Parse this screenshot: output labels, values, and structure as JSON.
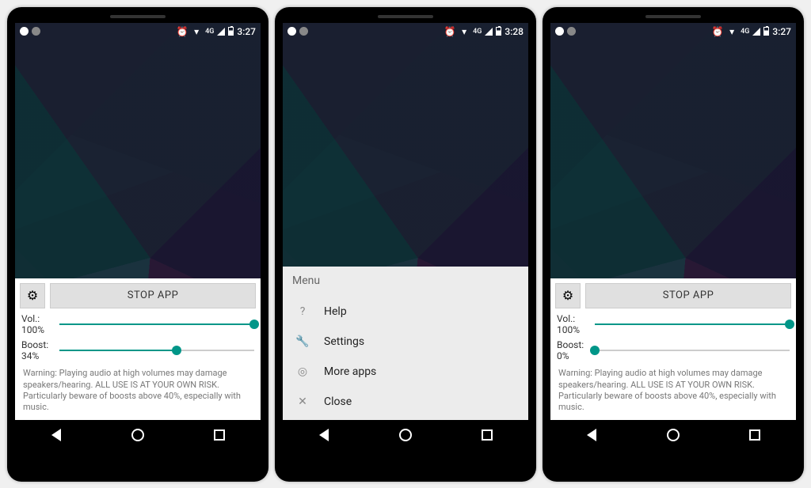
{
  "screens": [
    {
      "status": {
        "time": "3:27",
        "network": "4G"
      },
      "panel": {
        "stop_label": "STOP APP",
        "vol": {
          "label": "Vol.:",
          "value_label": "100%",
          "value": 100
        },
        "boost": {
          "label": "Boost:",
          "value_label": "34%",
          "value": 34
        },
        "warning": "Warning: Playing audio at high volumes may damage speakers/hearing. ALL USE IS AT YOUR OWN RISK. Particularly beware of boosts above 40%, especially with music."
      }
    },
    {
      "status": {
        "time": "3:28",
        "network": "4G"
      },
      "menu": {
        "title": "Menu",
        "items": [
          {
            "icon": "?",
            "label": "Help"
          },
          {
            "icon": "🔧",
            "label": "Settings"
          },
          {
            "icon": "◎",
            "label": "More apps"
          },
          {
            "icon": "✕",
            "label": "Close"
          }
        ]
      }
    },
    {
      "status": {
        "time": "3:27",
        "network": "4G"
      },
      "panel": {
        "stop_label": "STOP APP",
        "vol": {
          "label": "Vol.:",
          "value_label": "100%",
          "value": 100
        },
        "boost": {
          "label": "Boost:",
          "value_label": "0%",
          "value": 0
        },
        "warning": "Warning: Playing audio at high volumes may damage speakers/hearing. ALL USE IS AT YOUR OWN RISK. Particularly beware of boosts above 40%, especially with music."
      }
    }
  ]
}
